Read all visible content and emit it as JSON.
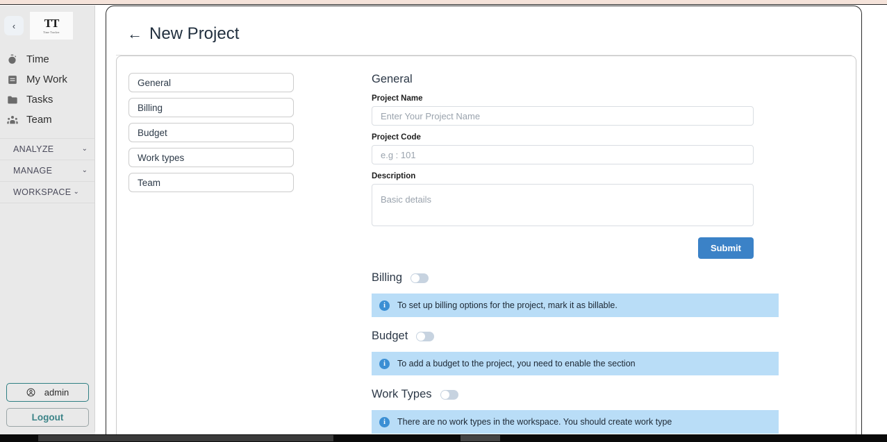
{
  "app": {
    "logo_mark": "TT",
    "logo_subtitle": "Time Tracker"
  },
  "sidebar": {
    "collapse_icon": "‹",
    "nav_items": [
      {
        "label": "Time",
        "icon": "stopwatch-icon"
      },
      {
        "label": "My Work",
        "icon": "document-list-icon"
      },
      {
        "label": "Tasks",
        "icon": "folder-icon"
      },
      {
        "label": "Team",
        "icon": "people-icon"
      }
    ],
    "sections": [
      {
        "label": "ANALYZE",
        "chevron": "⌄"
      },
      {
        "label": "MANAGE",
        "chevron": "⌄"
      },
      {
        "label": "WORKSPACE",
        "chevron": "⌄"
      }
    ],
    "user_label": "admin",
    "logout_label": "Logout"
  },
  "header": {
    "back_arrow": "←",
    "title": "New Project"
  },
  "tabs": [
    {
      "label": "General"
    },
    {
      "label": "Billing"
    },
    {
      "label": "Budget"
    },
    {
      "label": "Work types"
    },
    {
      "label": "Team"
    }
  ],
  "general": {
    "section_title": "General",
    "fields": [
      {
        "label": "Project Name",
        "placeholder": "Enter Your Project Name",
        "value": ""
      },
      {
        "label": "Project Code",
        "placeholder": "e.g : 101",
        "value": ""
      },
      {
        "label": "Description",
        "placeholder": "Basic details",
        "value": ""
      }
    ],
    "submit_label": "Submit"
  },
  "sections": [
    {
      "title": "Billing",
      "toggle_state": "off",
      "alert": "To set up billing options for the project, mark it as billable."
    },
    {
      "title": "Budget",
      "toggle_state": "off",
      "alert": "To add a budget to the project, you need to enable the section"
    },
    {
      "title": "Work Types",
      "toggle_state": "off",
      "alert": "There are no work types in the workspace. You should create work type"
    }
  ],
  "colors": {
    "accent_blue": "#3b82c7",
    "alert_bg": "#b9ddf7",
    "info_icon": "#3b8fd4",
    "teal_border": "#2f7f83",
    "teal_text": "#3b8387",
    "top_strip": "#f5e3da",
    "sidebar_bg": "#e9e9e9"
  }
}
